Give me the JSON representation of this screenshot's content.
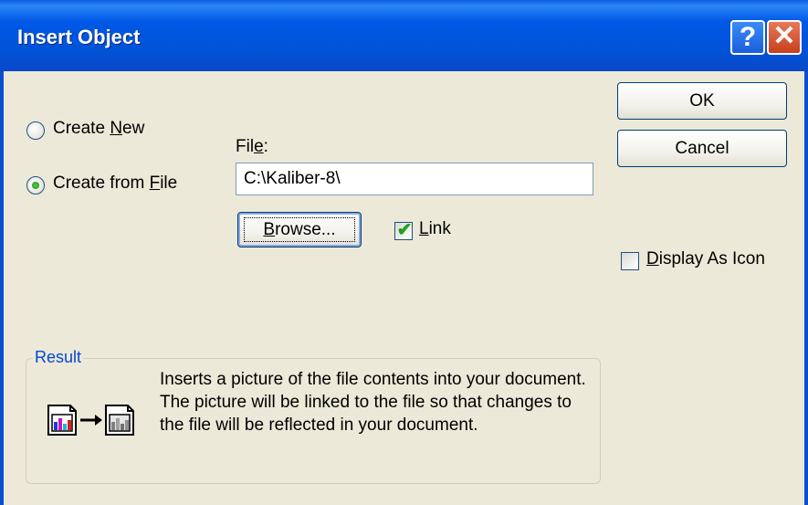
{
  "dialog": {
    "title": "Insert Object",
    "help_button": "?",
    "close_button": "✕"
  },
  "options": {
    "create_new": {
      "prefix": "Create ",
      "accel": "N",
      "suffix": "ew",
      "selected": false
    },
    "create_from_file": {
      "prefix": "Create from ",
      "accel": "F",
      "suffix": "ile",
      "selected": true
    }
  },
  "file": {
    "label_prefix": "Fil",
    "label_accel": "e",
    "label_suffix": ":",
    "value": "C:\\Kaliber-8\\"
  },
  "browse_button": {
    "accel": "B",
    "rest": "rowse..."
  },
  "link_checkbox": {
    "accel": "L",
    "rest": "ink",
    "checked": true
  },
  "buttons": {
    "ok": "OK",
    "cancel": "Cancel"
  },
  "display_as_icon": {
    "accel": "D",
    "rest": "isplay As Icon",
    "checked": false
  },
  "result": {
    "title": "Result",
    "description": "Inserts a picture of the file contents into your document.  The picture will be linked to the file so that changes to the file will be reflected in your document.",
    "icon": "linked-picture-icon"
  },
  "colors": {
    "titlebar": "#0058e6",
    "dialog_bg": "#ece9d8",
    "group_title": "#0046d5",
    "check": "#21a121"
  }
}
